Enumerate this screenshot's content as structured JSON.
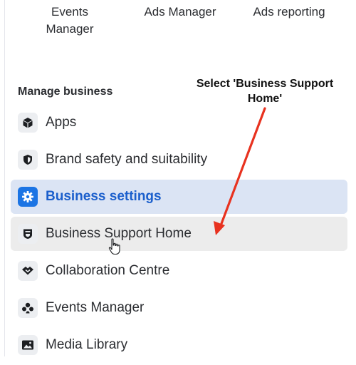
{
  "top_links": {
    "events_manager": "Events\nManager",
    "ads_manager": "Ads Manager",
    "ads_reporting": "Ads reporting"
  },
  "section": {
    "title": "Manage business"
  },
  "menu": {
    "items": [
      {
        "label": "Apps",
        "icon": "cube-icon"
      },
      {
        "label": "Brand safety and suitability",
        "icon": "shield-icon"
      },
      {
        "label": "Business settings",
        "icon": "gear-icon",
        "active": true
      },
      {
        "label": "Business Support Home",
        "icon": "support-badge-icon",
        "hovered": true
      },
      {
        "label": "Collaboration Centre",
        "icon": "handshake-icon"
      },
      {
        "label": "Events Manager",
        "icon": "people-group-icon"
      },
      {
        "label": "Media Library",
        "icon": "image-icon"
      }
    ]
  },
  "annotation": {
    "text": "Select 'Business Support Home'"
  },
  "colors": {
    "accent": "#1b74e4",
    "active_bg": "#dbe4f4",
    "hover_bg": "#ececec",
    "arrow": "#e8321f"
  }
}
